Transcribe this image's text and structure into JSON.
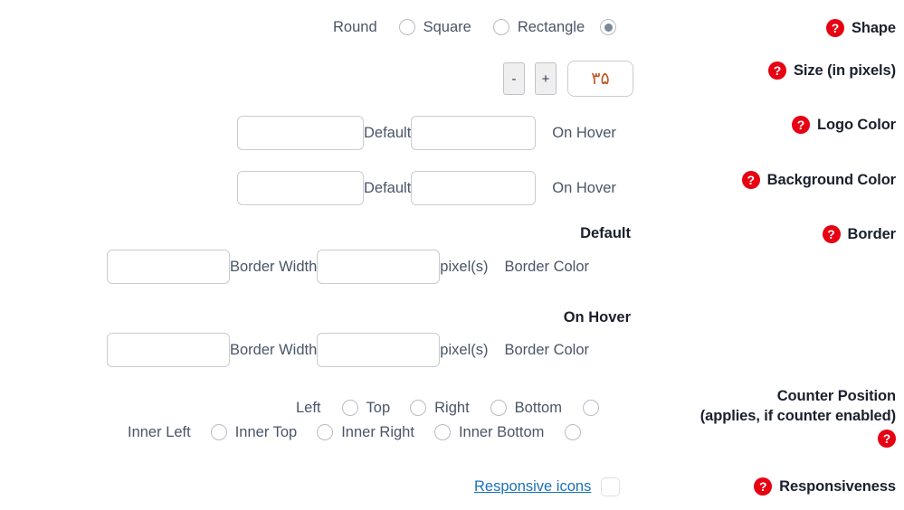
{
  "shape": {
    "label": "Shape",
    "help_icon": "question-help-icon",
    "options": [
      {
        "label": "Round",
        "selected": true
      },
      {
        "label": "Square",
        "selected": false
      },
      {
        "label": "Rectangle",
        "selected": false
      }
    ]
  },
  "size": {
    "label": "Size (in pixels)",
    "help_icon": "question-help-icon",
    "decrement_label": "-",
    "increment_label": "+",
    "value": "۳۵",
    "placeholder": ""
  },
  "logo_color": {
    "label": "Logo Color",
    "help_icon": "question-help-icon",
    "default_label": "Default",
    "hover_label": "On Hover",
    "default_value": "",
    "hover_value": "",
    "placeholder": ""
  },
  "background_color": {
    "label": "Background Color",
    "help_icon": "question-help-icon",
    "default_label": "Default",
    "hover_label": "On Hover",
    "default_value": "",
    "hover_value": "",
    "placeholder": ""
  },
  "border": {
    "label": "Border",
    "help_icon": "question-help-icon",
    "default_head": "Default",
    "hover_head": "On Hover",
    "width_label": "Border Width",
    "pixels_label": "pixel(s)",
    "color_label": "Border Color",
    "default_width_value": "",
    "default_color_value": "",
    "hover_width_value": "",
    "hover_color_value": "",
    "placeholder": ""
  },
  "counter_position": {
    "label_line1": "Counter Position",
    "label_line2": "(applies, if counter enabled)",
    "help_icon": "question-help-icon",
    "options": [
      {
        "label": "Left",
        "selected": false
      },
      {
        "label": "Top",
        "selected": false
      },
      {
        "label": "Right",
        "selected": false
      },
      {
        "label": "Bottom",
        "selected": false
      },
      {
        "label": "Inner Left",
        "selected": false
      },
      {
        "label": "Inner Top",
        "selected": false
      },
      {
        "label": "Inner Right",
        "selected": false
      },
      {
        "label": "Inner Bottom",
        "selected": false
      }
    ]
  },
  "responsiveness": {
    "label": "Responsiveness",
    "help_icon": "question-help-icon",
    "link_label": "Responsive icons",
    "checked": false
  },
  "colors": {
    "help_icon_red": "#e60012",
    "link_blue": "#1a73b8",
    "text_dark": "#1a202c",
    "text_body": "#4a5568",
    "input_border": "#c9ccd2",
    "radio_fill": "#7a8899",
    "value_orange": "#c05621"
  }
}
